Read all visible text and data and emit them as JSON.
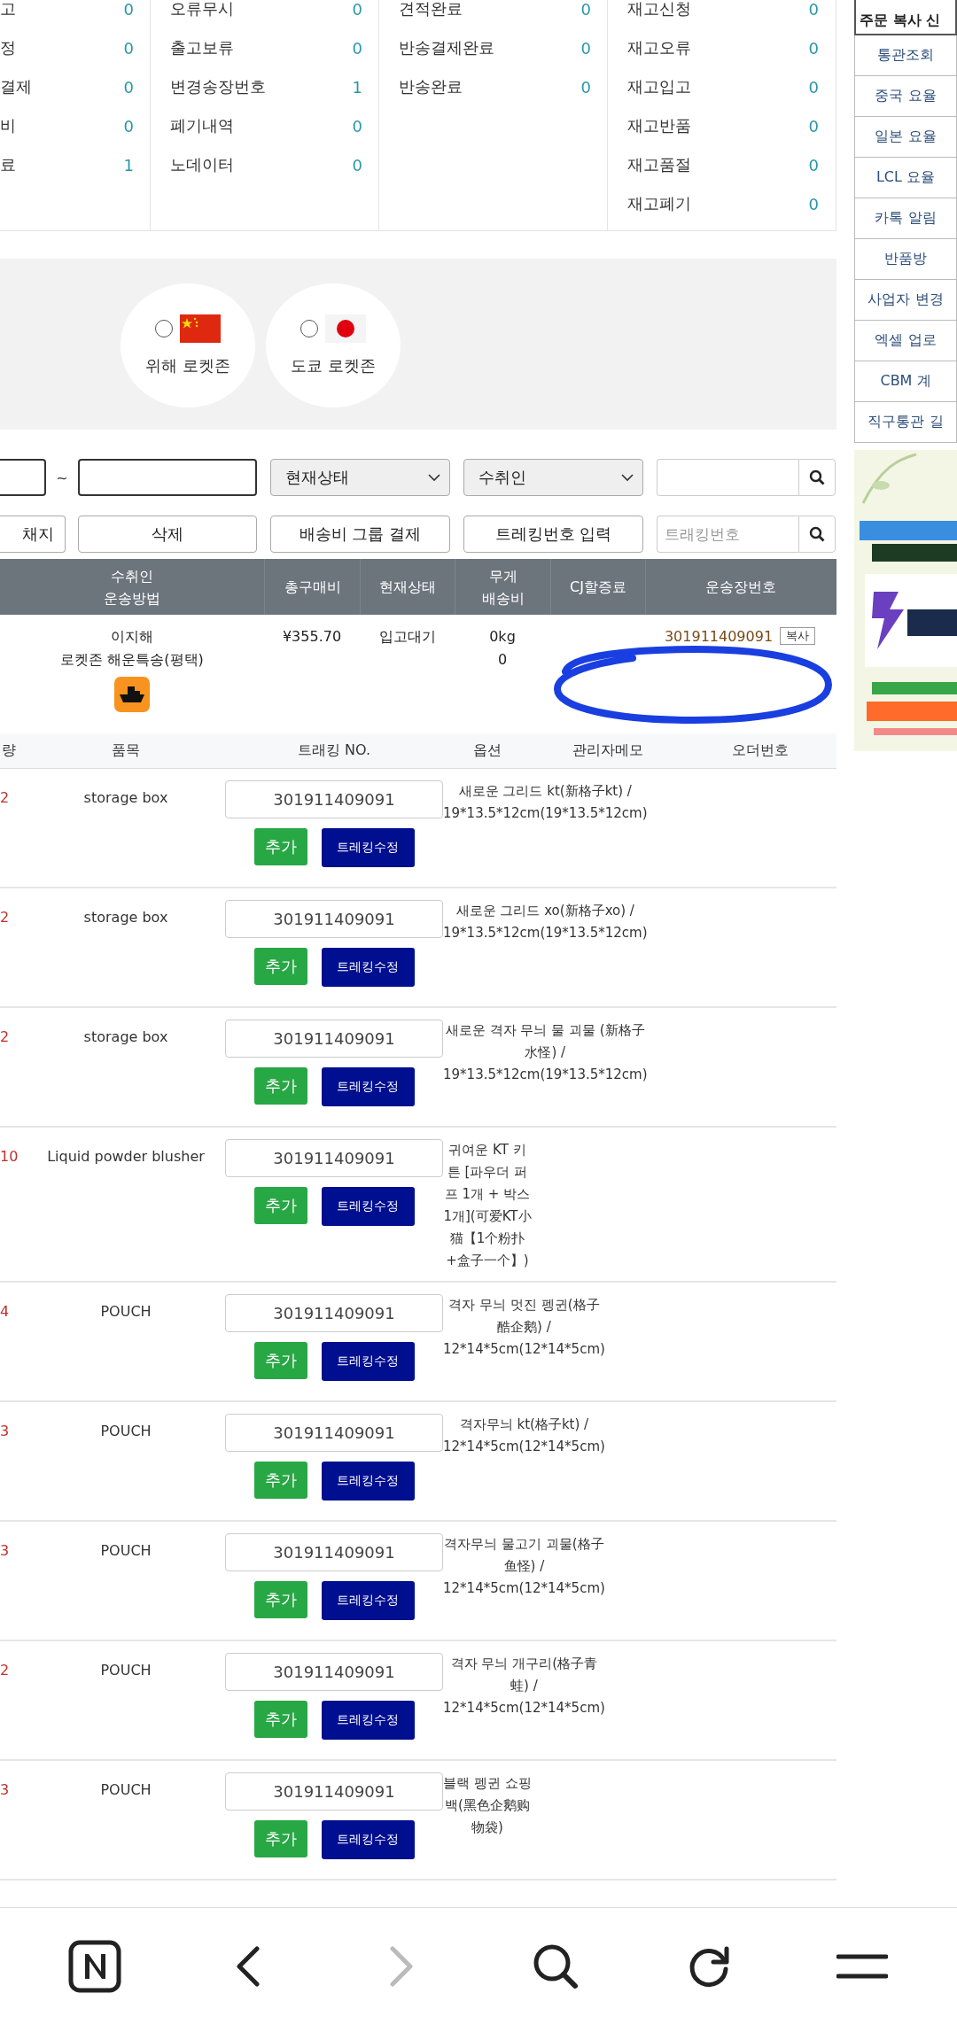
{
  "stats": [
    {
      "rows": [
        {
          "label": "고",
          "count": "0"
        },
        {
          "label": "정",
          "count": "0"
        },
        {
          "label": "결제",
          "count": "0"
        },
        {
          "label": "비",
          "count": "0"
        },
        {
          "label": "료",
          "count": "1"
        }
      ]
    },
    {
      "rows": [
        {
          "label": "오류무시",
          "count": "0"
        },
        {
          "label": "출고보류",
          "count": "0"
        },
        {
          "label": "변경송장번호",
          "count": "1"
        },
        {
          "label": "폐기내역",
          "count": "0"
        },
        {
          "label": "노데이터",
          "count": "0"
        }
      ]
    },
    {
      "rows": [
        {
          "label": "견적완료",
          "count": "0"
        },
        {
          "label": "반송결제완료",
          "count": "0"
        },
        {
          "label": "반송완료",
          "count": "0"
        }
      ]
    },
    {
      "rows": [
        {
          "label": "재고신청",
          "count": "0"
        },
        {
          "label": "재고오류",
          "count": "0"
        },
        {
          "label": "재고입고",
          "count": "0"
        },
        {
          "label": "재고반품",
          "count": "0"
        },
        {
          "label": "재고품절",
          "count": "0"
        },
        {
          "label": "재고폐기",
          "count": "0"
        }
      ]
    }
  ],
  "zones": [
    {
      "label": "위해 로켓존",
      "kind": "china",
      "selected": false
    },
    {
      "label": "도쿄 로켓존",
      "kind": "japan",
      "selected": false
    }
  ],
  "filters": {
    "tilde": "~",
    "status_select": "현재상태",
    "recipient_select": "수취인"
  },
  "actions": [
    {
      "label": "채지"
    },
    {
      "label": "삭제"
    },
    {
      "label": "배송비 그룹 결제"
    },
    {
      "label": "트레킹번호 입력"
    }
  ],
  "tracking_search": {
    "placeholder": "트래킹번호"
  },
  "order_table": {
    "columns": [
      [
        "수취인",
        "운송방법"
      ],
      [
        "총구매비"
      ],
      [
        "현재상태"
      ],
      [
        "무게",
        "배송비"
      ],
      [
        "CJ할증료"
      ],
      [
        "운송장번호"
      ]
    ],
    "row": {
      "recipient": "이지해",
      "method": "로켓존 해운특송(평택)",
      "total": "¥355.70",
      "status": "입고대기",
      "weight": "0kg",
      "shipping_fee": "0",
      "waybill": "301911409091",
      "copy": "복사"
    }
  },
  "item_table": {
    "columns": [
      "량",
      "품목",
      "트래킹 NO.",
      "옵션",
      "관리자메모",
      "오더번호"
    ],
    "rows": [
      {
        "qty": "2",
        "name": "storage box",
        "tracking": "301911409091",
        "add": "추가",
        "edit": "트레킹수정",
        "option": "새로운 그리드 kt(新格子kt) / 19*13.5*12cm(19*13.5*12cm)"
      },
      {
        "qty": "2",
        "name": "storage box",
        "tracking": "301911409091",
        "add": "추가",
        "edit": "트레킹수정",
        "option": "새로운 그리드 xo(新格子xo) / 19*13.5*12cm(19*13.5*12cm)"
      },
      {
        "qty": "2",
        "name": "storage box",
        "tracking": "301911409091",
        "add": "추가",
        "edit": "트레킹수정",
        "option": "새로운 격자 무늬 물 괴물 (新格子水怪) / 19*13.5*12cm(19*13.5*12cm)"
      },
      {
        "qty": "10",
        "name": "Liquid powder blusher",
        "tracking": "301911409091",
        "add": "추가",
        "edit": "트레킹수정",
        "option": "귀여운 KT 키튼 [파우더 퍼프 1개 + 박스 1개](可爱KT小猫【1个粉扑+盒子一个】)"
      },
      {
        "qty": "4",
        "name": "POUCH",
        "tracking": "301911409091",
        "add": "추가",
        "edit": "트레킹수정",
        "option": "격자 무늬 멋진 펭귄(格子酷企鹅) / 12*14*5cm(12*14*5cm)"
      },
      {
        "qty": "3",
        "name": "POUCH",
        "tracking": "301911409091",
        "add": "추가",
        "edit": "트레킹수정",
        "option": "격자무늬 kt(格子kt) / 12*14*5cm(12*14*5cm)"
      },
      {
        "qty": "3",
        "name": "POUCH",
        "tracking": "301911409091",
        "add": "추가",
        "edit": "트레킹수정",
        "option": "격자무늬 물고기 괴물(格子鱼怪) / 12*14*5cm(12*14*5cm)"
      },
      {
        "qty": "2",
        "name": "POUCH",
        "tracking": "301911409091",
        "add": "추가",
        "edit": "트레킹수정",
        "option": "격자 무늬 개구리(格子青蛙) / 12*14*5cm(12*14*5cm)"
      },
      {
        "qty": "3",
        "name": "POUCH",
        "tracking": "301911409091",
        "add": "추가",
        "edit": "트레킹수정",
        "option": "블랙 펭귄 쇼핑백(黑色企鹅购物袋)"
      }
    ]
  },
  "sidebar": {
    "header": "주문 복사 신",
    "items": [
      "통관조회",
      "중국 요율",
      "일본 요율",
      "LCL 요율",
      "카톡 알림",
      "반품방",
      "사업자 변경",
      "엑셀 업로",
      "CBM 계",
      "직구통관 길"
    ]
  },
  "nav_bar": [
    {
      "kind": "home"
    },
    {
      "kind": "back",
      "disabled": false
    },
    {
      "kind": "forward",
      "disabled": true
    },
    {
      "kind": "search"
    },
    {
      "kind": "reload"
    },
    {
      "kind": "menu"
    }
  ]
}
